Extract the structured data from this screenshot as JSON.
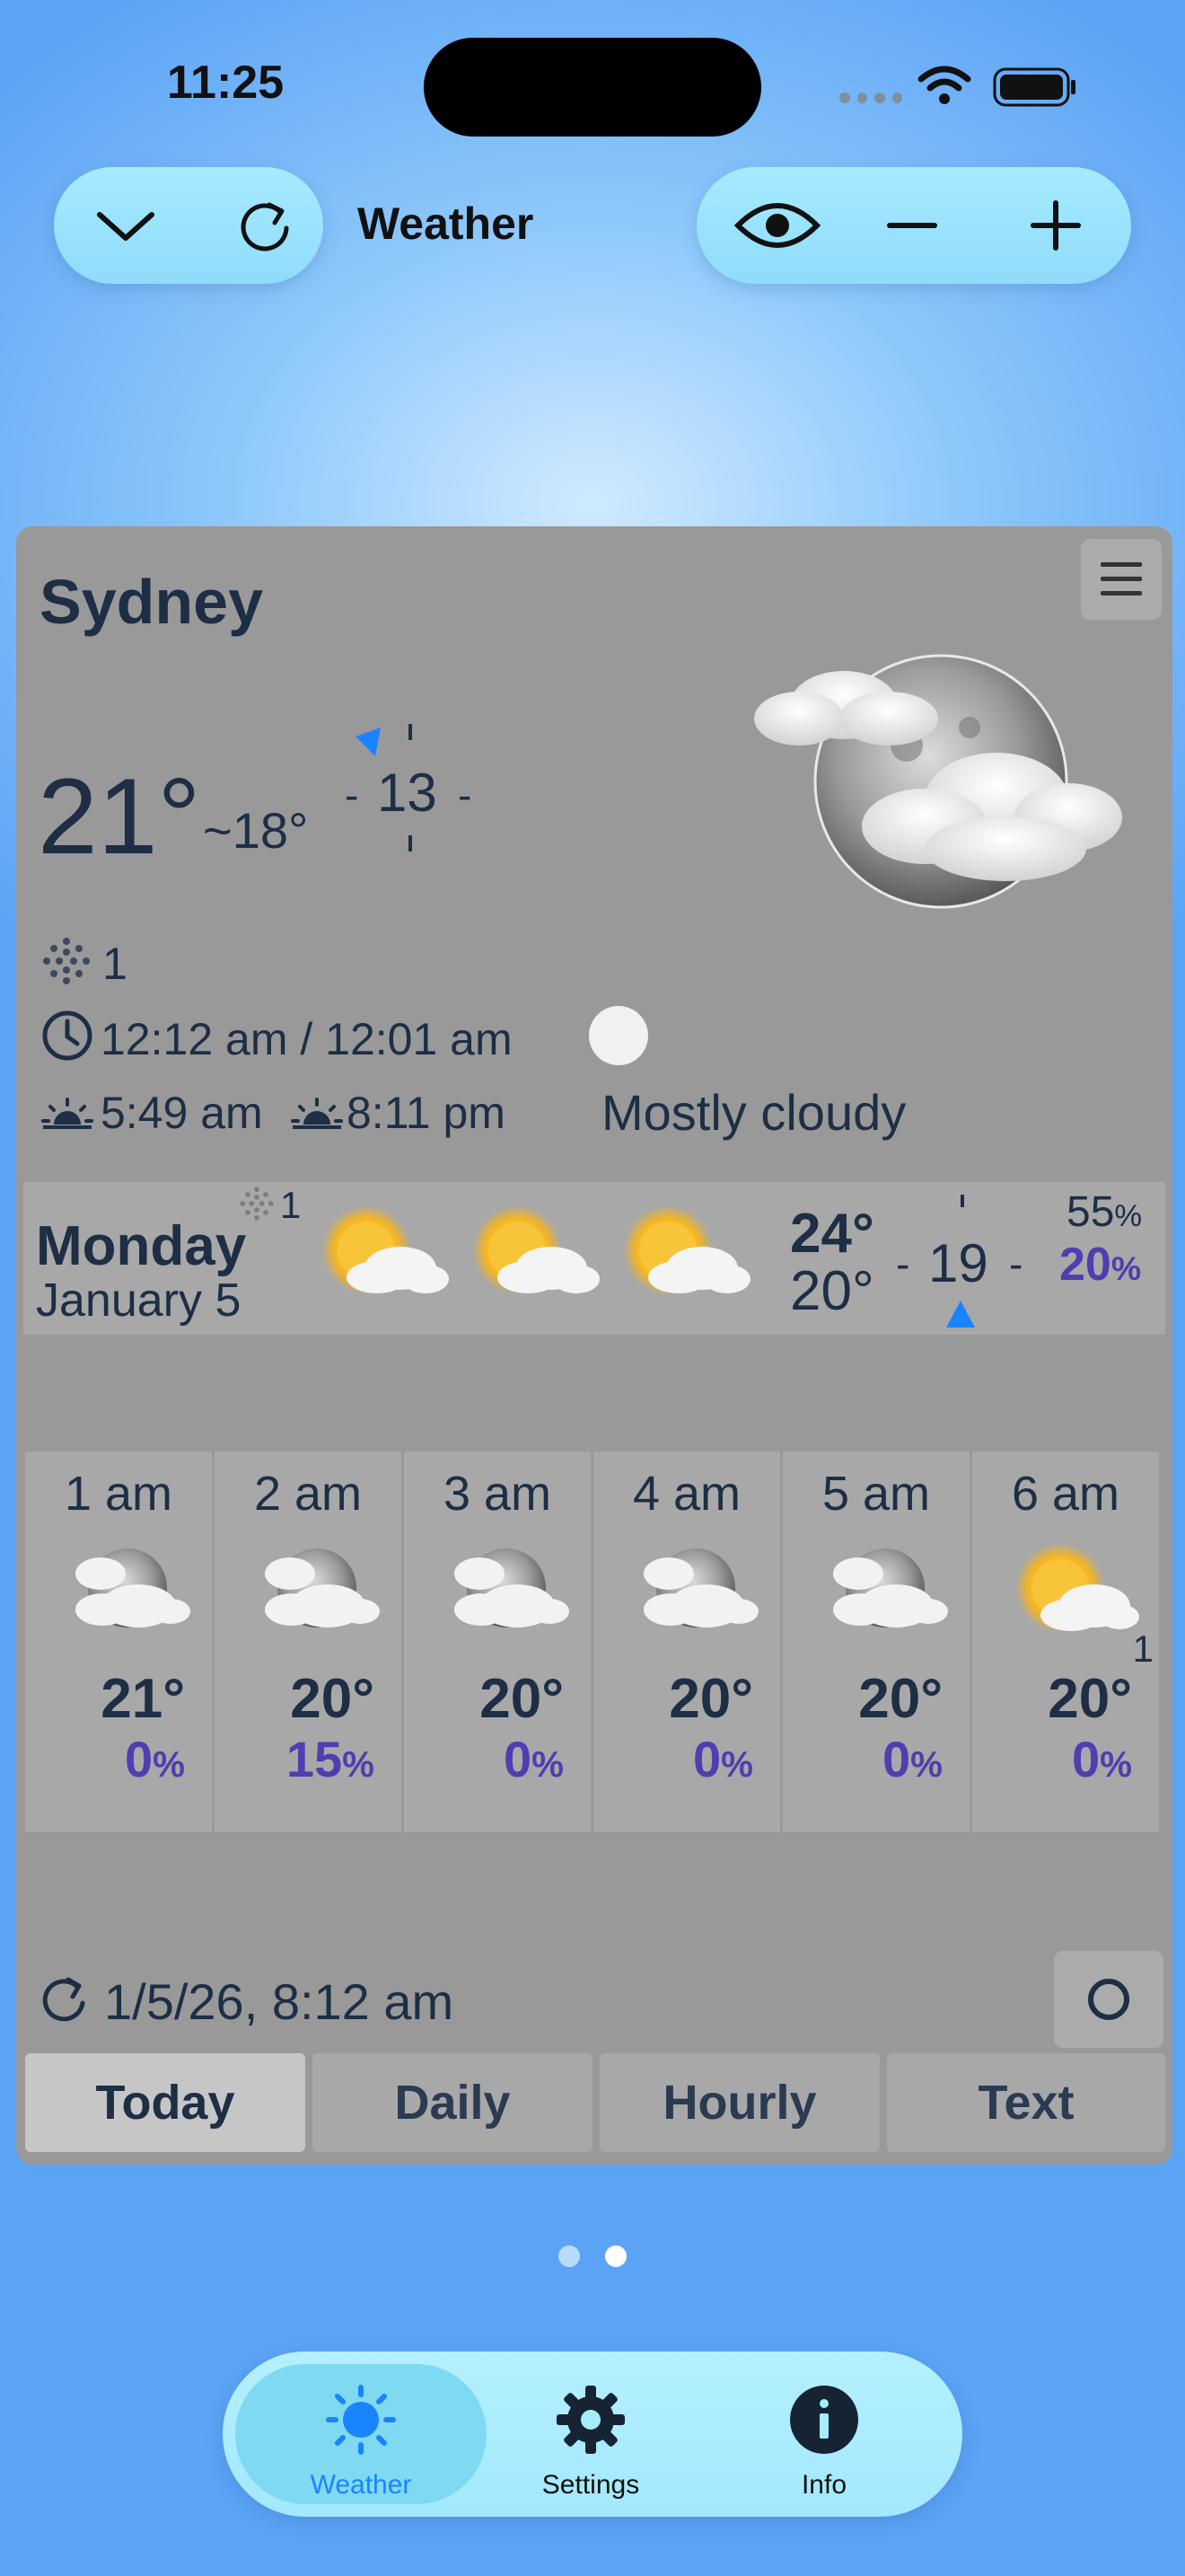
{
  "status_bar": {
    "time": "11:25"
  },
  "toolbar": {
    "title": "Weather"
  },
  "location": {
    "city": "Sydney"
  },
  "current": {
    "temperature": "21°",
    "feels_like": "~18°",
    "wind_speed": "13",
    "rain_mm": "1",
    "time_range": "12:12 am / 12:01 am",
    "sunrise": "5:49 am",
    "sunset": "8:11 pm",
    "condition": "Mostly cloudy"
  },
  "daily": {
    "day": "Monday",
    "date": "January 5",
    "rain_mm": "1",
    "high": "24°",
    "low": "20°",
    "wind_speed": "19",
    "humidity": "55",
    "precip_chance": "20",
    "pct_sign": "%"
  },
  "hourly": [
    {
      "time": "1 am",
      "temp": "21°",
      "pop": "0",
      "icon": "cloudy-moon-icon"
    },
    {
      "time": "2 am",
      "temp": "20°",
      "pop": "15",
      "icon": "cloudy-moon-icon"
    },
    {
      "time": "3 am",
      "temp": "20°",
      "pop": "0",
      "icon": "cloudy-moon-icon"
    },
    {
      "time": "4 am",
      "temp": "20°",
      "pop": "0",
      "icon": "cloudy-moon-icon"
    },
    {
      "time": "5 am",
      "temp": "20°",
      "pop": "0",
      "icon": "cloudy-moon-icon"
    },
    {
      "time": "6 am",
      "temp": "20°",
      "pop": "0",
      "icon": "partly-sunny-icon",
      "badge": "1"
    }
  ],
  "updated": "1/5/26, 8:12 am",
  "tabs": [
    {
      "label": "Today"
    },
    {
      "label": "Daily"
    },
    {
      "label": "Hourly"
    },
    {
      "label": "Text"
    }
  ],
  "bottom_nav": [
    {
      "label": "Weather"
    },
    {
      "label": "Settings"
    },
    {
      "label": "Info"
    }
  ],
  "colors": {
    "accent": "#1a84ff",
    "card": "#999999",
    "precip": "#4e3fb0",
    "text": "#1d2e45"
  }
}
